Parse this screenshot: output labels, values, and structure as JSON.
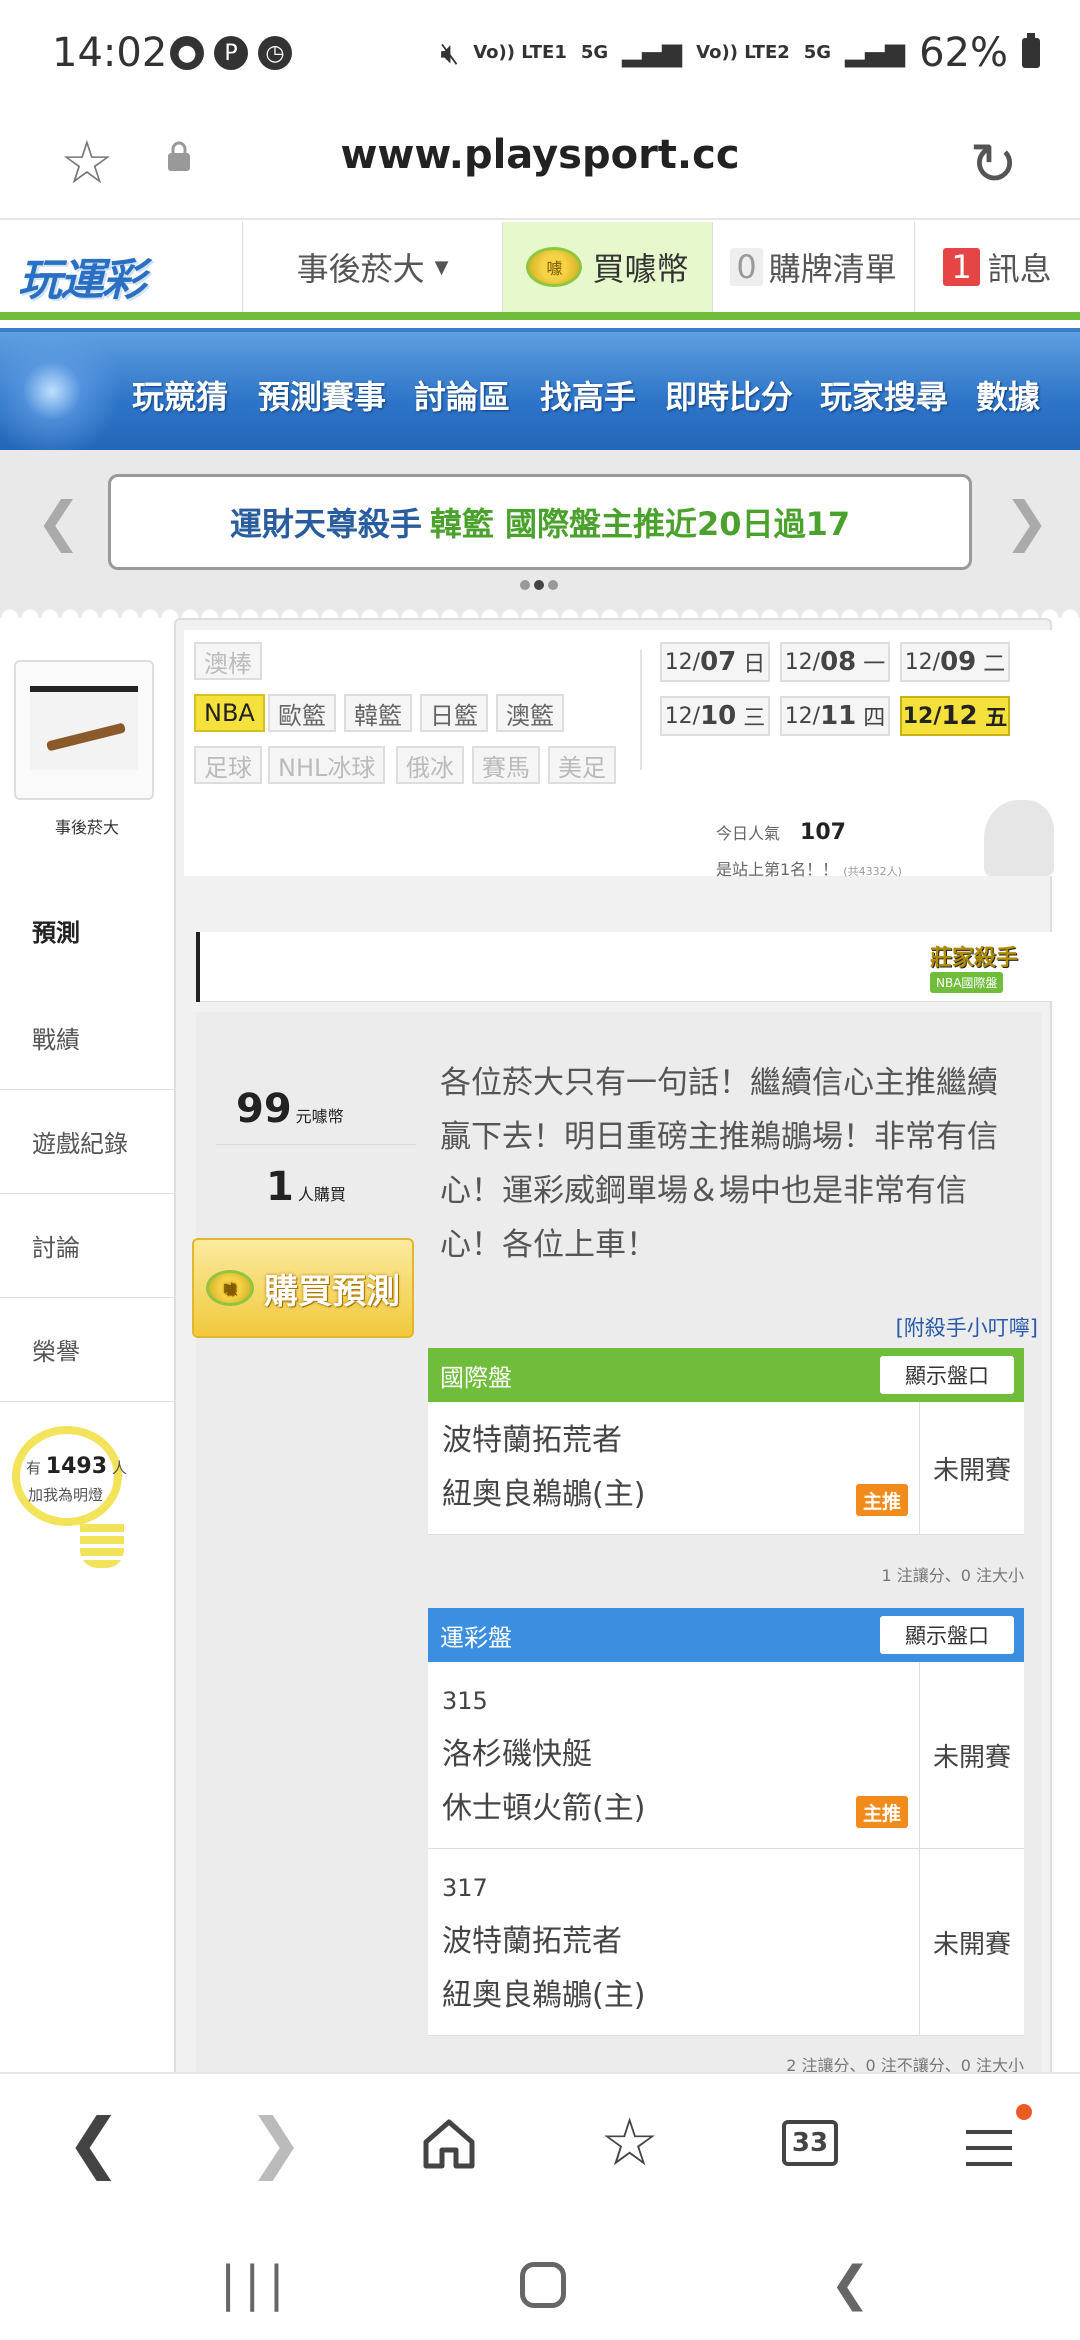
{
  "status_bar": {
    "time": "14:02",
    "lte1": "Vo)) LTE1",
    "net1": "5G",
    "lte2": "Vo)) LTE2",
    "net2": "5G",
    "battery": "62%"
  },
  "url_bar": {
    "url": "www.playsport.cc"
  },
  "site_header": {
    "logo": "玩運彩",
    "user": "事後菸大",
    "buy_coins": "買噱幣",
    "cart_count": "0",
    "cart_label": "購牌清單",
    "msg_count": "1",
    "msg_label": "訊息",
    "coin_glyph": "噱"
  },
  "main_nav": [
    "玩競猜",
    "預測賽事",
    "討論區",
    "找高手",
    "即時比分",
    "玩家搜尋",
    "數據"
  ],
  "marquee": {
    "part1": "運財天尊殺手",
    "part2": "韓籃 國際盤主推近20日過17"
  },
  "sidebar": {
    "username": "事後菸大",
    "items": [
      "預測",
      "戰績",
      "遊戲紀錄",
      "討論",
      "榮譽"
    ],
    "followers_prefix": "有",
    "followers_count": "1493",
    "followers_suffix": "人",
    "followers_sub": "加我為明燈"
  },
  "filters": {
    "row1": [
      "澳棒"
    ],
    "row2": [
      "NBA",
      "歐籃",
      "韓籃",
      "日籃",
      "澳籃"
    ],
    "row3": [
      "足球",
      "NHL冰球",
      "俄冰",
      "賽馬",
      "美足"
    ],
    "selected_league": "NBA",
    "dates": [
      {
        "md": "12/",
        "d": "07",
        "w": "日"
      },
      {
        "md": "12/",
        "d": "08",
        "w": "一"
      },
      {
        "md": "12/",
        "d": "09",
        "w": "二"
      },
      {
        "md": "12/",
        "d": "10",
        "w": "三"
      },
      {
        "md": "12/",
        "d": "11",
        "w": "四"
      },
      {
        "md": "12/",
        "d": "12",
        "w": "五"
      }
    ],
    "selected_date": "12/12 五"
  },
  "popularity": {
    "label": "今日人氣",
    "value": "107",
    "rank": "是站上第1名！！",
    "total": "(共4332人)"
  },
  "badge": {
    "title": "莊家殺手",
    "sub": "NBA國際盤"
  },
  "prediction": {
    "price": "99",
    "price_unit": "元噱幣",
    "buyers": "1",
    "buyers_unit": "人購買",
    "buy_button": "購買預測",
    "comment": "各位菸大只有一句話！繼續信心主推繼續贏下去！明日重磅主推鵜鶘場！非常有信心！運彩威鋼單場＆場中也是非常有信心！各位上車！",
    "tips_link": "[附殺手小叮嚀]"
  },
  "intl_panel": {
    "title": "國際盤",
    "show_button": "顯示盤口",
    "team1": "波特蘭拓荒者",
    "team2": "紐奧良鵜鶘(主)",
    "pick_label": "主推",
    "state": "未開賽",
    "note": "1 注讓分、0 注大小"
  },
  "lottery_panel": {
    "title": "運彩盤",
    "show_button": "顯示盤口",
    "games": [
      {
        "no": "315",
        "team1": "洛杉磯快艇",
        "team2": "休士頓火箭(主)",
        "pick": "主推",
        "state": "未開賽"
      },
      {
        "no": "317",
        "team1": "波特蘭拓荒者",
        "team2": "紐奧良鵜鶘(主)",
        "pick": "",
        "state": "未開賽"
      }
    ],
    "note": "2 注讓分、0 注不讓分、0 注大小"
  },
  "browser_bar": {
    "tabs_count": "33"
  }
}
